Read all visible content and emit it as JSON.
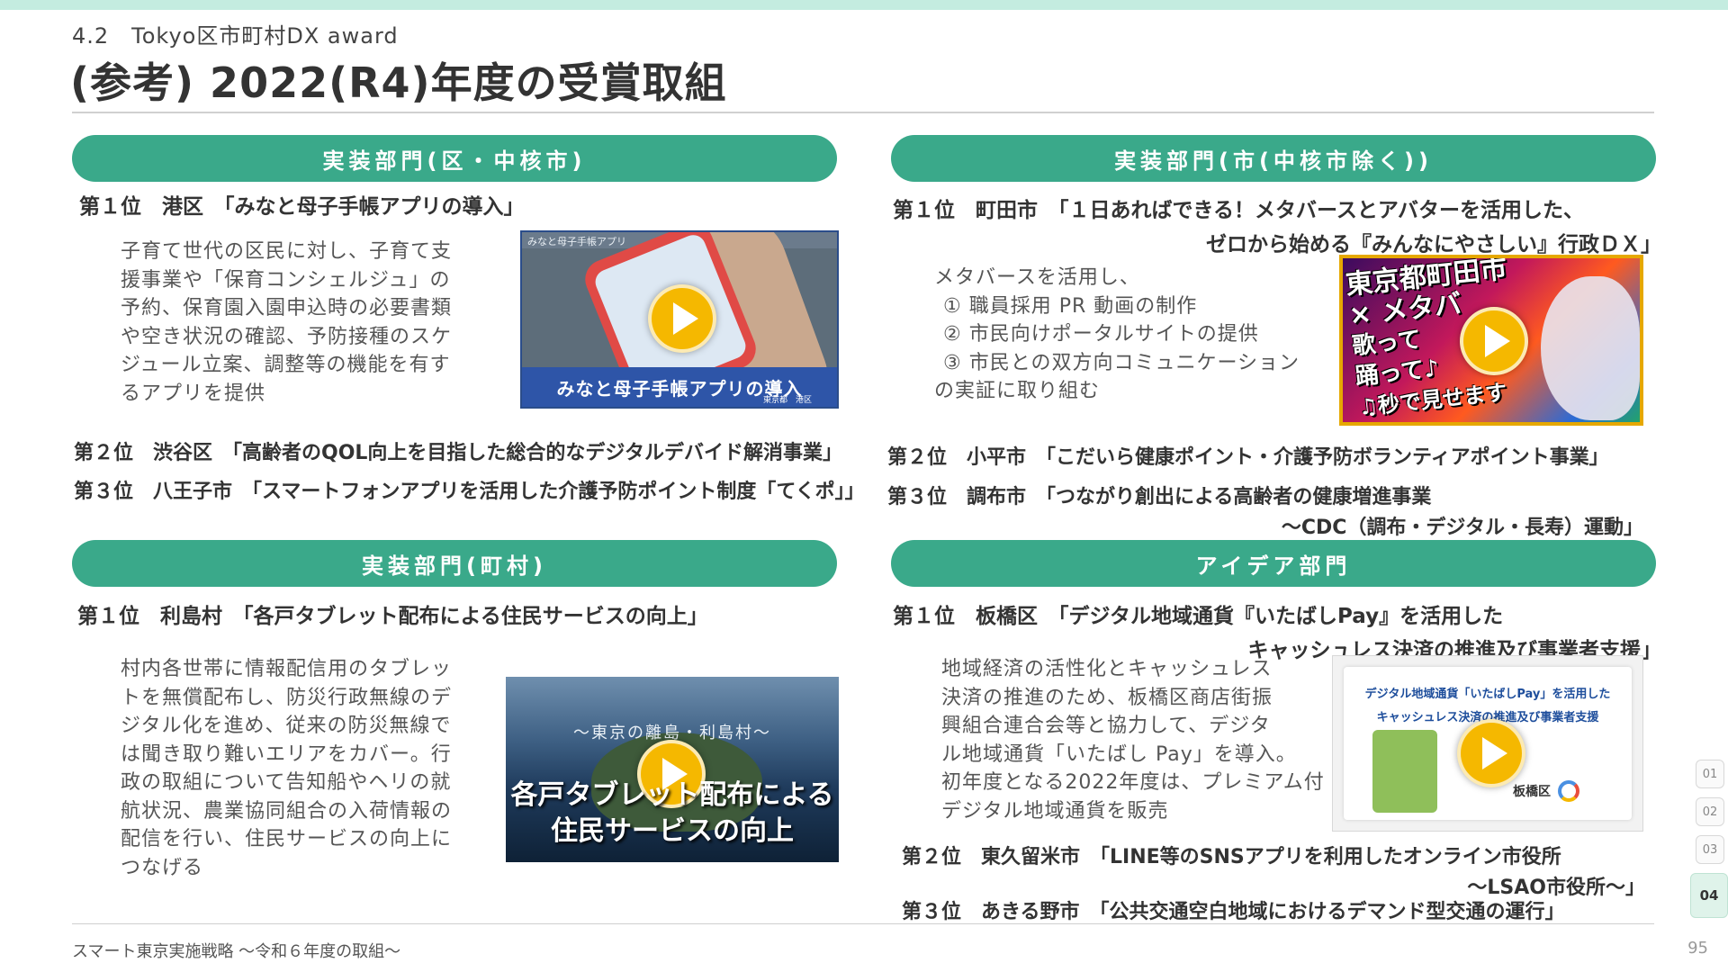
{
  "header": {
    "section": "4.2　Tokyo区市町村DX award",
    "title": "(参考) 2022(R4)年度の受賞取組"
  },
  "panels": {
    "ku": {
      "heading": "実装部門(区・中核市)",
      "first": "第１位　港区　「みなと母子手帳アプリの導入」",
      "description": [
        "子育て世代の区民に対し、子育て支",
        "援事業や「保育コンシェルジュ」の",
        "予約、保育園入園申込時の必要書類",
        "や空き状況の確認、予防接種のスケ",
        "ジュール立案、調整等の機能を有す",
        "るアプリを提供"
      ],
      "thumb_caption": "みなと母子手帳アプリの導入",
      "thumb_credit": "東京都　港区",
      "thumb_header": "みなと母子手帳アプリ",
      "second": "第２位　渋谷区　「高齢者のQOL向上を目指した総合的なデジタルデバイド解消事業」",
      "third": "第３位　八王子市　「スマートフォンアプリを活用した介護予防ポイント制度「てくポ」」"
    },
    "shi": {
      "heading": "実装部門(市(中核市除く))",
      "first_line1": "第１位　町田市　「１日あればできる！メタバースとアバターを活用した、",
      "first_line2": "ゼロから始める『みんなにやさしい』行政ＤＸ」",
      "description": [
        "メタバースを活用し、",
        "  ① 職員採用 PR 動画の制作",
        "  ② 市民向けポータルサイトの提供",
        "  ③ 市民との双方向コミュニケーション",
        "の実証に取り組む"
      ],
      "thumb_text": [
        "東京都町田市",
        "× メタバ",
        "歌って",
        "踊って♪",
        "♫秒で見せます"
      ],
      "second": "第２位　小平市　「こだいら健康ポイント・介護予防ボランティアポイント事業」",
      "third_line1": "第３位　調布市　「つながり創出による高齢者の健康増進事業",
      "third_line2": "～CDC（調布・デジタル・長寿）運動」"
    },
    "choson": {
      "heading": "実装部門(町村)",
      "first": "第１位　利島村　「各戸タブレット配布による住民サービスの向上」",
      "description": [
        "村内各世帯に情報配信用のタブレッ",
        "トを無償配布し、防災行政無線のデ",
        "ジタル化を進め、従来の防災無線で",
        "は聞き取り難いエリアをカバー。行",
        "政の取組について告知船やヘリの就",
        "航状況、農業協同組合の入荷情報の",
        "配信を行い、住民サービスの向上に",
        "つなげる"
      ],
      "thumb_sub": "～東京の離島・利島村～",
      "thumb_main": [
        "各戸タブレット配布による",
        "住民サービスの向上"
      ]
    },
    "idea": {
      "heading": "アイデア部門",
      "first_line1": "第１位　板橋区　「デジタル地域通貨『いたばしPay』を活用した",
      "first_line2": "キャッシュレス決済の推進及び事業者支援」",
      "description": [
        "地域経済の活性化とキャッシュレス",
        "決済の推進のため、板橋区商店街振",
        "興組合連合会等と協力して、デジタ",
        "ル地域通貨「いたばし Pay」を導入。",
        "初年度となる2022年度は、プレミアム付",
        "デジタル地域通貨を販売"
      ],
      "thumb_text": [
        "デジタル地域通貨「いたばしPay」を活用した",
        "キャッシュレス決済の推進及び事業者支援"
      ],
      "thumb_logo": "板橋区",
      "second_line1": "第２位　東久留米市　「LINE等のSNSアプリを利用したオンライン市役所",
      "second_line2": "～LSAO市役所～」",
      "third": "第３位　あきる野市　「公共交通空白地域におけるデマンド型交通の運行」"
    }
  },
  "footer": {
    "text": "スマート東京実施戦略 ～令和６年度の取組～",
    "page": "95"
  },
  "tabs": [
    "01",
    "02",
    "03",
    "04"
  ],
  "colors": {
    "accent": "#3aa98a",
    "stripe": "#c4ece0",
    "play": "#f5b800"
  }
}
